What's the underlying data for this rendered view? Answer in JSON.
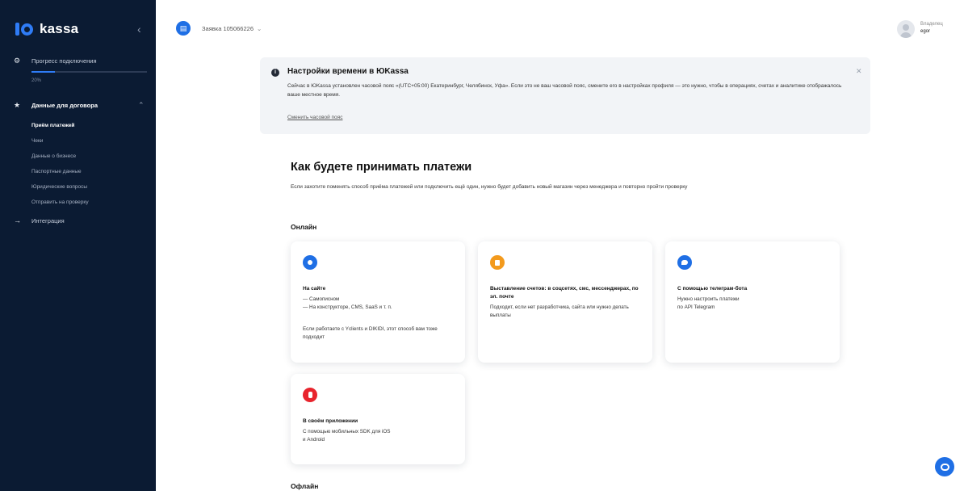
{
  "brand": {
    "logo_text": "kassa",
    "accent": "#2f7cf6",
    "sidebar_bg": "#0b1b33"
  },
  "sidebar": {
    "collapse_icon": "chevron-left-icon",
    "progress": {
      "label": "Прогресс подключения",
      "value_text": "20%",
      "value": 0.2
    },
    "contract": {
      "label": "Данные для договора",
      "icon": "star-icon"
    },
    "contract_items": [
      {
        "label": "Приём платежей",
        "active": true
      },
      {
        "label": "Чеки"
      },
      {
        "label": "Данные о бизнесе"
      },
      {
        "label": "Паспортные данные"
      },
      {
        "label": "Юридические вопросы"
      },
      {
        "label": "Отправить на проверку"
      }
    ],
    "integration": {
      "label": "Интеграция",
      "icon": "arrow-right-icon"
    }
  },
  "header": {
    "shop_icon": "store-icon",
    "shop_name": "Заявка 105066226",
    "owner_label": "Владелец",
    "owner_name": "egor"
  },
  "alert": {
    "title": "Настройки времени в ЮKassa",
    "text": "Сейчас в ЮKassa установлен часовой пояс «(UTC+05:00) Екатеринбург, Челябинск, Уфа». Если это не ваш часовой пояс, смените его в настройках профиля — это нужно, чтобы в операциях, счетах и аналитике отображалось ваше местное время.",
    "link": "Сменить часовой пояс",
    "close_icon": "close-icon"
  },
  "main": {
    "heading": "Как будете принимать платежи",
    "description": "Если захотите поменять способ приёма платежей или подключить ещё один, нужно будет добавить новый магазин через менеджера и повторно пройти проверку",
    "online_title": "Онлайн",
    "offline_title": "Офлайн",
    "cards": [
      {
        "icon": "globe-icon",
        "color": "#1f6fe5",
        "title": "На сайте",
        "lines": [
          "— Самописном",
          "— На конструкторе, CMS, SaaS и т. п."
        ],
        "note": "Если работаете с Yclients и DIKIDI, этот способ вам тоже подходит"
      },
      {
        "icon": "invoice-icon",
        "color": "#f39a1d",
        "title": "Выставление счетов: в соцсетях, смс, мессенджерах, по эл. почте",
        "lines": [
          "Подходит, если нет разработчика, сайта или нужно делать выплаты"
        ],
        "note": ""
      },
      {
        "icon": "telegram-icon",
        "color": "#1f6fe5",
        "title": "С помощью телеграм-бота",
        "lines": [
          "Нужно настроить платежи",
          "по API Telegram"
        ],
        "note": ""
      },
      {
        "icon": "app-icon",
        "color": "#e8242d",
        "title": "В своём приложении",
        "lines": [
          "С помощью мобильных SDK для iOS",
          "и Android"
        ],
        "note": ""
      }
    ]
  },
  "chat": {
    "icon": "chat-icon",
    "color": "#1f6fe5"
  }
}
